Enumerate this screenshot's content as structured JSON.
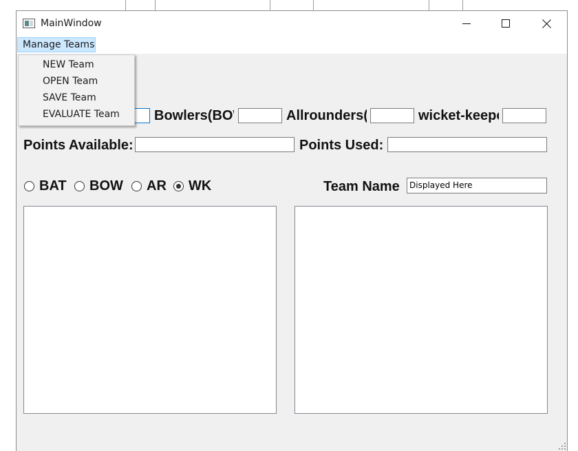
{
  "window": {
    "title": "MainWindow",
    "icons": [
      "app-icon",
      "minimize-icon",
      "maximize-icon",
      "close-icon"
    ]
  },
  "menu": {
    "manage_teams": "Manage Teams",
    "items": [
      "NEW Team",
      "OPEN Team",
      "SAVE Team",
      "EVALUATE Team"
    ]
  },
  "labels": {
    "bowlers": "Bowlers(BOW)",
    "allrounders": "Allrounders(AR)",
    "wicket_keepers": "wicket-keepers(WK)",
    "points_available": "Points Available:",
    "points_used": "Points Used:",
    "team_name": "Team Name"
  },
  "inputs": {
    "batsmen_count": "",
    "bowlers_count": "",
    "allrounders_count": "",
    "wicket_keepers_count": "",
    "points_available": "",
    "points_used": "",
    "team_name": "Displayed Here"
  },
  "radios": [
    {
      "label": "BAT",
      "checked": false
    },
    {
      "label": "BOW",
      "checked": false
    },
    {
      "label": "AR",
      "checked": false
    },
    {
      "label": "WK",
      "checked": true
    }
  ],
  "colors": {
    "menu_highlight": "#cce8ff",
    "window_bg": "#f0f0f0",
    "focused_border": "#0078d7"
  }
}
